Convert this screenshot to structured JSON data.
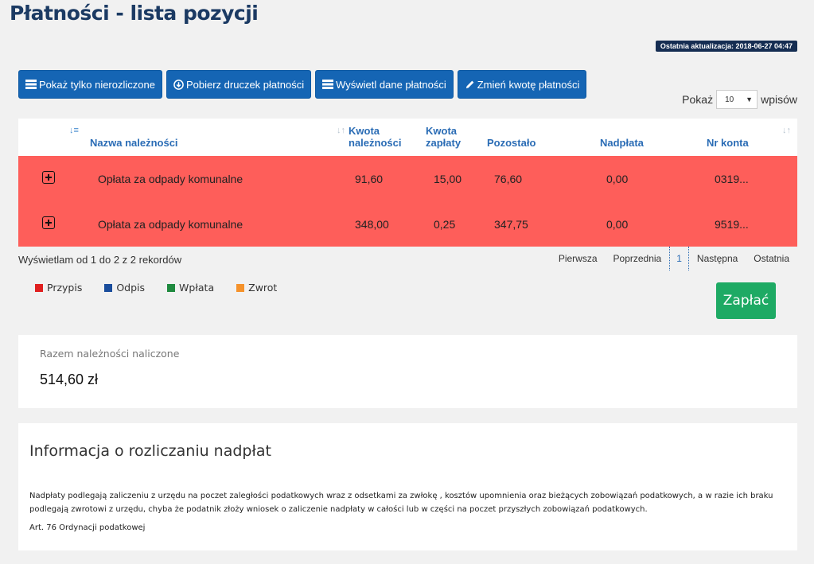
{
  "page": {
    "title": "Płatności - lista pozycji",
    "last_update": "Ostatnia aktualizacja: 2018-06-27 04:47"
  },
  "toolbar": {
    "buttons": [
      {
        "label": "Pokaż tylko nierozliczone",
        "icon": "list-icon"
      },
      {
        "label": "Pobierz druczek płatności",
        "icon": "download-icon"
      },
      {
        "label": "Wyświetl dane płatności",
        "icon": "list-icon"
      },
      {
        "label": "Zmień kwotę płatności",
        "icon": "pencil-icon"
      }
    ]
  },
  "entries": {
    "prefix": "Pokaż",
    "value": "10",
    "suffix": "wpisów"
  },
  "table": {
    "headers": {
      "name": "Nazwa należności",
      "amount_due_1": "Kwota",
      "amount_due_2": "należności",
      "amount_paid_1": "Kwota",
      "amount_paid_2": "zapłaty",
      "remaining": "Pozostało",
      "overpaid": "Nadpłata",
      "account": "Nr konta"
    },
    "rows": [
      {
        "name": "Opłata za odpady komunalne",
        "amount_due": "91,60",
        "amount_paid": "15,00",
        "remaining": "76,60",
        "overpaid": "0,00",
        "account": "0319..."
      },
      {
        "name": "Opłata za odpady komunalne",
        "amount_due": "348,00",
        "amount_paid": "0,25",
        "remaining": "347,75",
        "overpaid": "0,00",
        "account": "9519..."
      }
    ],
    "row_color": "#fe5e5a"
  },
  "records_info": "Wyświetlam od 1 do 2 z 2 rekordów",
  "pagination": {
    "first": "Pierwsza",
    "prev": "Poprzednia",
    "current": "1",
    "next": "Następna",
    "last": "Ostatnia"
  },
  "legend": [
    {
      "label": "Przypis",
      "color": "#e02020"
    },
    {
      "label": "Odpis",
      "color": "#1a4d9c"
    },
    {
      "label": "Wpłata",
      "color": "#1f8a3f"
    },
    {
      "label": "Zwrot",
      "color": "#f5922b"
    }
  ],
  "pay_button": "Zapłać",
  "summary": {
    "label": "Razem należności naliczone",
    "value": "514,60 zł"
  },
  "info": {
    "title": "Informacja o rozliczaniu nadpłat",
    "text": "Nadpłaty podlegają zaliczeniu z urzędu na poczet zaległości podatkowych wraz z odsetkami za zwłokę , kosztów upomnienia oraz bieżących zobowiązań podatkowych, a w razie ich braku podlegają zwrotowi z urzędu, chyba że podatnik złoży wniosek o zaliczenie nadpłaty w całości lub w części na poczet przyszłych zobowiązań podatkowych.",
    "reference": "Art. 76 Ordynacji podatkowej"
  }
}
